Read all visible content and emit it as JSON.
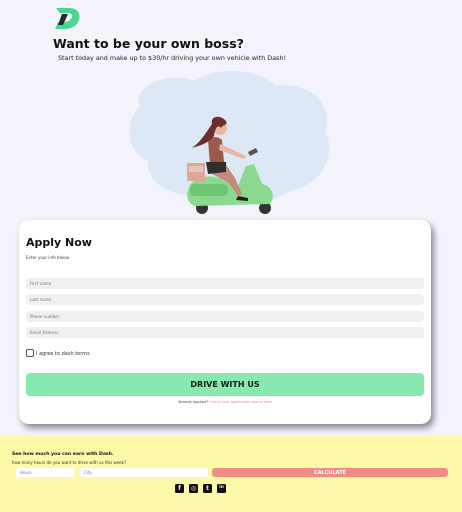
{
  "brand": {
    "logo_letter": "D",
    "accent": "#4cd68f"
  },
  "hero": {
    "title": "Want to be your own boss?",
    "subtitle": "Start today and make up to $30/hr driving your own vehicle with Dash!"
  },
  "apply": {
    "title": "Apply Now",
    "subtitle": "Enter your info below.",
    "fields": [
      {
        "placeholder": "First name"
      },
      {
        "placeholder": "Last name"
      },
      {
        "placeholder": "Phone number"
      },
      {
        "placeholder": "Email Address"
      }
    ],
    "terms_label": "I agree to dash terms",
    "submit_label": "DRIVE WITH US",
    "already_text": "Already applied?",
    "status_link": "Check your application status here"
  },
  "earnings": {
    "title": "See how much you can earn with Dash.",
    "question": "how many hours do you want to drive with us this week?",
    "hours_placeholder": "Hours",
    "city_placeholder": "City",
    "calculate_label": "CALCULATE"
  },
  "socials": [
    {
      "icon": "facebook-icon",
      "glyph": "f"
    },
    {
      "icon": "instagram-icon",
      "glyph": "◎"
    },
    {
      "icon": "twitter-icon",
      "glyph": "t"
    },
    {
      "icon": "linkedin-icon",
      "glyph": "in"
    }
  ],
  "colors": {
    "page_bg": "#f4f3fc",
    "button_green": "#87e9b0",
    "footer_yellow": "#fcf9a8",
    "calculate_red": "#ed8e86",
    "link_pink": "#e08a8a"
  }
}
